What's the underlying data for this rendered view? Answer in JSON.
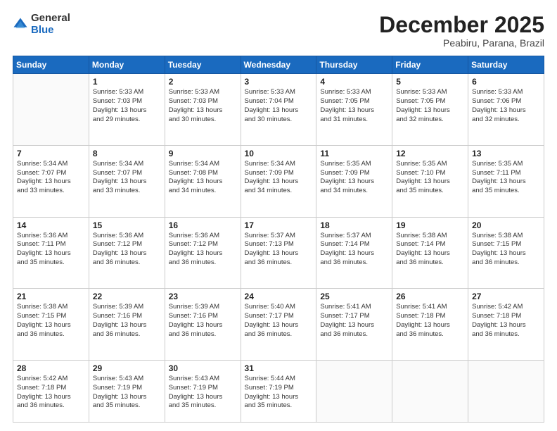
{
  "header": {
    "logo": {
      "general": "General",
      "blue": "Blue"
    },
    "title": "December 2025",
    "subtitle": "Peabiru, Parana, Brazil"
  },
  "calendar": {
    "days_of_week": [
      "Sunday",
      "Monday",
      "Tuesday",
      "Wednesday",
      "Thursday",
      "Friday",
      "Saturday"
    ],
    "weeks": [
      [
        {
          "day": "",
          "info": ""
        },
        {
          "day": "1",
          "info": "Sunrise: 5:33 AM\nSunset: 7:03 PM\nDaylight: 13 hours\nand 29 minutes."
        },
        {
          "day": "2",
          "info": "Sunrise: 5:33 AM\nSunset: 7:03 PM\nDaylight: 13 hours\nand 30 minutes."
        },
        {
          "day": "3",
          "info": "Sunrise: 5:33 AM\nSunset: 7:04 PM\nDaylight: 13 hours\nand 30 minutes."
        },
        {
          "day": "4",
          "info": "Sunrise: 5:33 AM\nSunset: 7:05 PM\nDaylight: 13 hours\nand 31 minutes."
        },
        {
          "day": "5",
          "info": "Sunrise: 5:33 AM\nSunset: 7:05 PM\nDaylight: 13 hours\nand 32 minutes."
        },
        {
          "day": "6",
          "info": "Sunrise: 5:33 AM\nSunset: 7:06 PM\nDaylight: 13 hours\nand 32 minutes."
        }
      ],
      [
        {
          "day": "7",
          "info": "Sunrise: 5:34 AM\nSunset: 7:07 PM\nDaylight: 13 hours\nand 33 minutes."
        },
        {
          "day": "8",
          "info": "Sunrise: 5:34 AM\nSunset: 7:07 PM\nDaylight: 13 hours\nand 33 minutes."
        },
        {
          "day": "9",
          "info": "Sunrise: 5:34 AM\nSunset: 7:08 PM\nDaylight: 13 hours\nand 34 minutes."
        },
        {
          "day": "10",
          "info": "Sunrise: 5:34 AM\nSunset: 7:09 PM\nDaylight: 13 hours\nand 34 minutes."
        },
        {
          "day": "11",
          "info": "Sunrise: 5:35 AM\nSunset: 7:09 PM\nDaylight: 13 hours\nand 34 minutes."
        },
        {
          "day": "12",
          "info": "Sunrise: 5:35 AM\nSunset: 7:10 PM\nDaylight: 13 hours\nand 35 minutes."
        },
        {
          "day": "13",
          "info": "Sunrise: 5:35 AM\nSunset: 7:11 PM\nDaylight: 13 hours\nand 35 minutes."
        }
      ],
      [
        {
          "day": "14",
          "info": "Sunrise: 5:36 AM\nSunset: 7:11 PM\nDaylight: 13 hours\nand 35 minutes."
        },
        {
          "day": "15",
          "info": "Sunrise: 5:36 AM\nSunset: 7:12 PM\nDaylight: 13 hours\nand 36 minutes."
        },
        {
          "day": "16",
          "info": "Sunrise: 5:36 AM\nSunset: 7:12 PM\nDaylight: 13 hours\nand 36 minutes."
        },
        {
          "day": "17",
          "info": "Sunrise: 5:37 AM\nSunset: 7:13 PM\nDaylight: 13 hours\nand 36 minutes."
        },
        {
          "day": "18",
          "info": "Sunrise: 5:37 AM\nSunset: 7:14 PM\nDaylight: 13 hours\nand 36 minutes."
        },
        {
          "day": "19",
          "info": "Sunrise: 5:38 AM\nSunset: 7:14 PM\nDaylight: 13 hours\nand 36 minutes."
        },
        {
          "day": "20",
          "info": "Sunrise: 5:38 AM\nSunset: 7:15 PM\nDaylight: 13 hours\nand 36 minutes."
        }
      ],
      [
        {
          "day": "21",
          "info": "Sunrise: 5:38 AM\nSunset: 7:15 PM\nDaylight: 13 hours\nand 36 minutes."
        },
        {
          "day": "22",
          "info": "Sunrise: 5:39 AM\nSunset: 7:16 PM\nDaylight: 13 hours\nand 36 minutes."
        },
        {
          "day": "23",
          "info": "Sunrise: 5:39 AM\nSunset: 7:16 PM\nDaylight: 13 hours\nand 36 minutes."
        },
        {
          "day": "24",
          "info": "Sunrise: 5:40 AM\nSunset: 7:17 PM\nDaylight: 13 hours\nand 36 minutes."
        },
        {
          "day": "25",
          "info": "Sunrise: 5:41 AM\nSunset: 7:17 PM\nDaylight: 13 hours\nand 36 minutes."
        },
        {
          "day": "26",
          "info": "Sunrise: 5:41 AM\nSunset: 7:18 PM\nDaylight: 13 hours\nand 36 minutes."
        },
        {
          "day": "27",
          "info": "Sunrise: 5:42 AM\nSunset: 7:18 PM\nDaylight: 13 hours\nand 36 minutes."
        }
      ],
      [
        {
          "day": "28",
          "info": "Sunrise: 5:42 AM\nSunset: 7:18 PM\nDaylight: 13 hours\nand 36 minutes."
        },
        {
          "day": "29",
          "info": "Sunrise: 5:43 AM\nSunset: 7:19 PM\nDaylight: 13 hours\nand 35 minutes."
        },
        {
          "day": "30",
          "info": "Sunrise: 5:43 AM\nSunset: 7:19 PM\nDaylight: 13 hours\nand 35 minutes."
        },
        {
          "day": "31",
          "info": "Sunrise: 5:44 AM\nSunset: 7:19 PM\nDaylight: 13 hours\nand 35 minutes."
        },
        {
          "day": "",
          "info": ""
        },
        {
          "day": "",
          "info": ""
        },
        {
          "day": "",
          "info": ""
        }
      ]
    ]
  }
}
